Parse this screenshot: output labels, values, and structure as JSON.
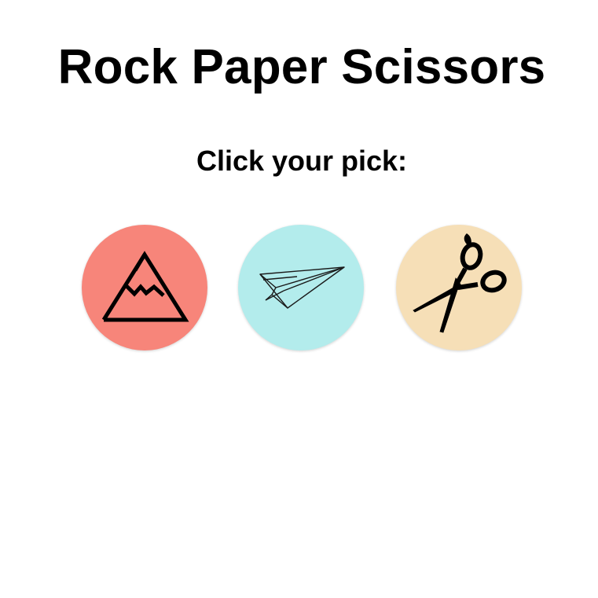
{
  "header": {
    "title": "Rock Paper Scissors",
    "prompt": "Click your pick:"
  },
  "choices": [
    {
      "id": "rock",
      "icon": "mountain-icon",
      "color": "#f7857a"
    },
    {
      "id": "paper",
      "icon": "paper-plane-icon",
      "color": "#b3ecec"
    },
    {
      "id": "scissors",
      "icon": "scissors-icon",
      "color": "#f6dfb7"
    }
  ]
}
